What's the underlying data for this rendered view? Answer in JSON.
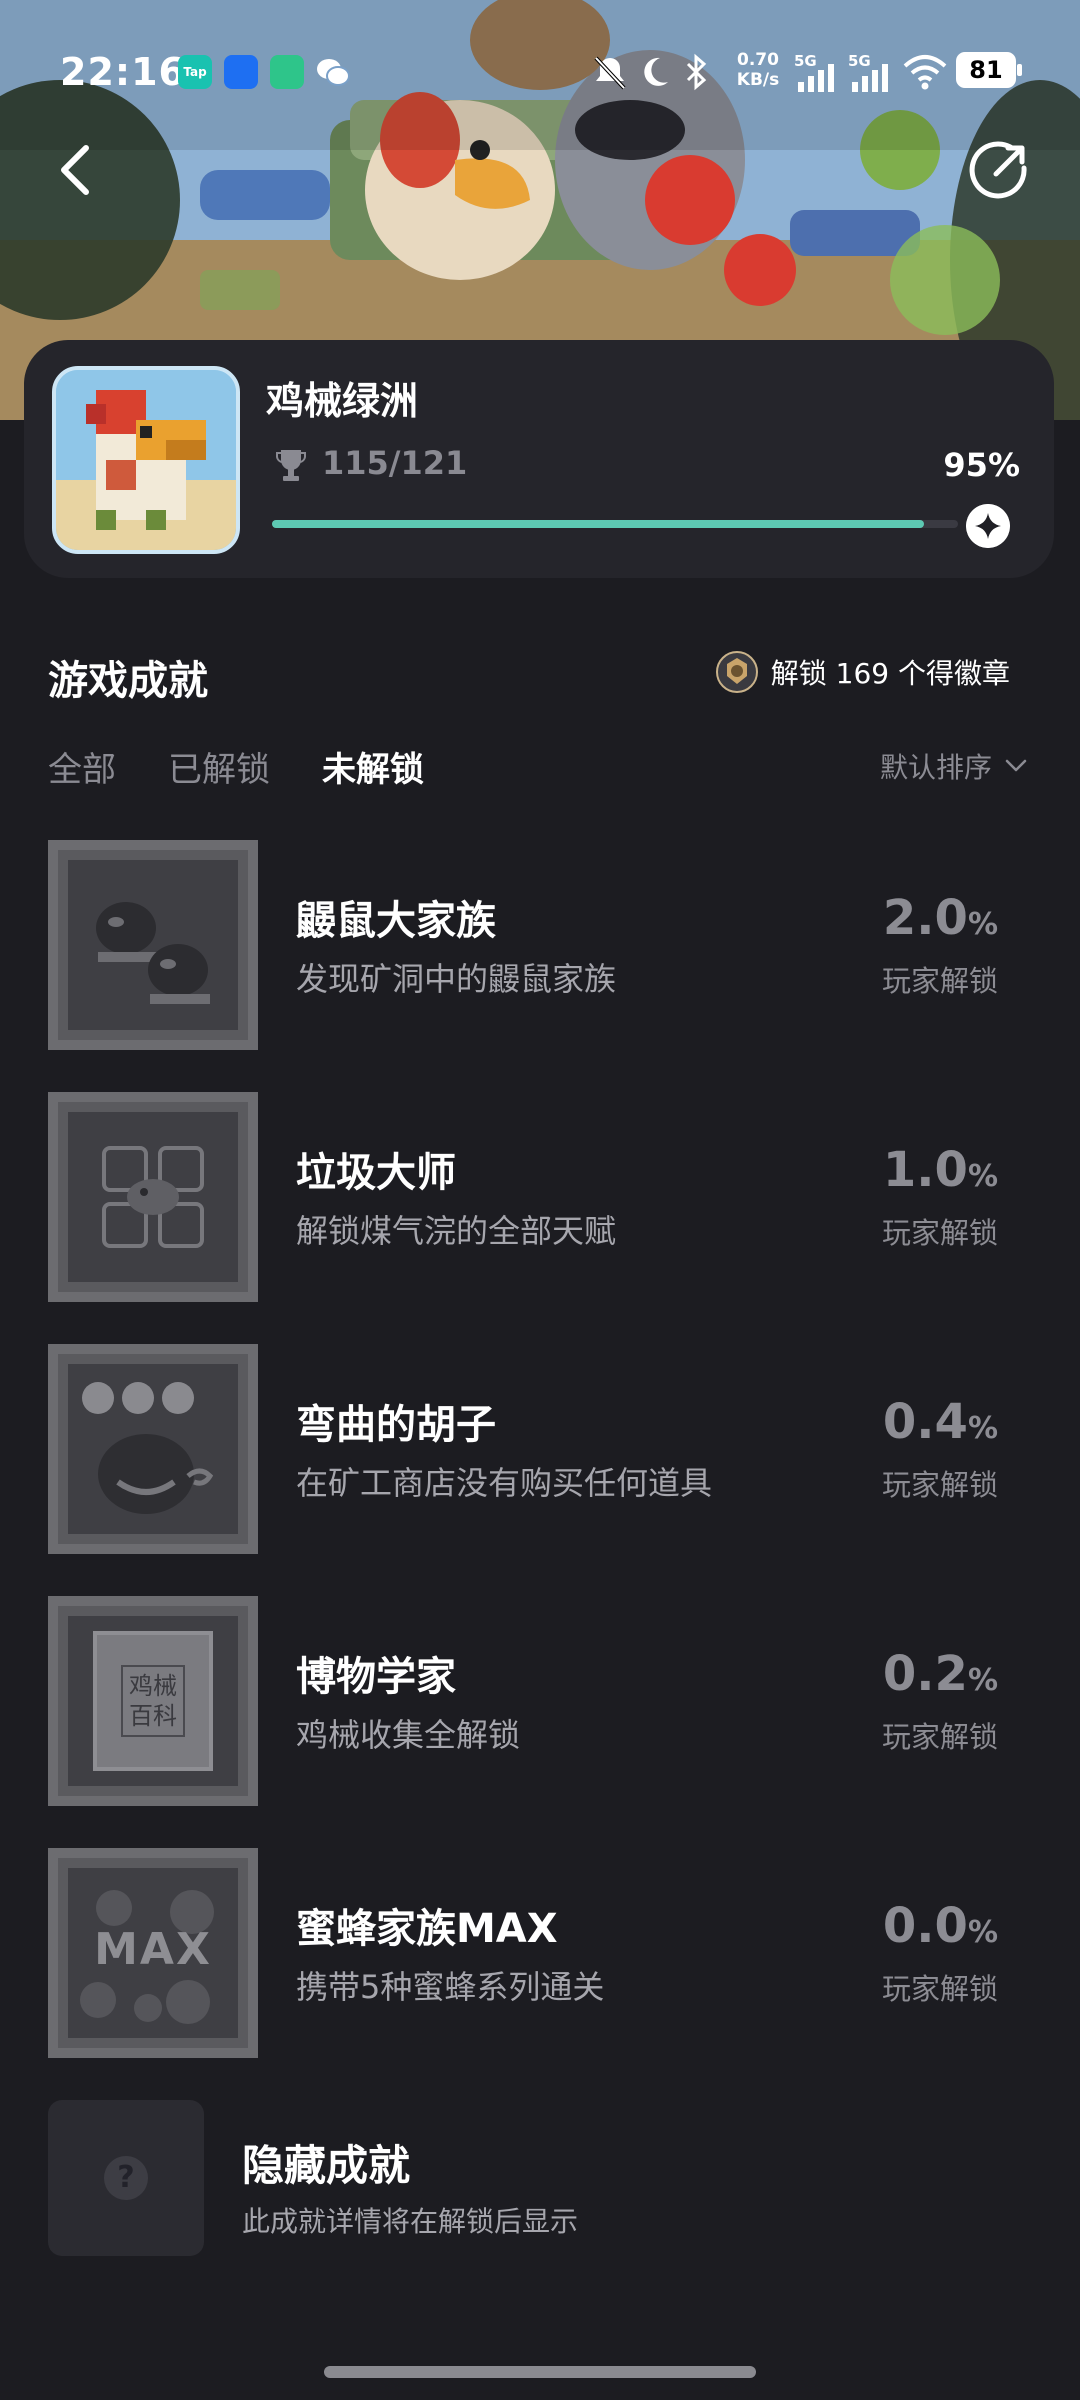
{
  "status_bar": {
    "time": "22:16",
    "apps": [
      "Tap",
      "transfer-app-icon",
      "box-app-icon",
      "wechat-icon"
    ],
    "net_speed_value": "0.70",
    "net_speed_unit": "KB/s",
    "sim1": "5G",
    "sim2": "5G",
    "battery": "81"
  },
  "nav": {
    "back_icon": "chevron-left-icon",
    "share_icon": "share-icon"
  },
  "game": {
    "title": "鸡械绿洲",
    "trophies": "115/121",
    "percent_text": "95%",
    "progress": 0.95
  },
  "achievements_section": {
    "title": "游戏成就",
    "badge_text": "解锁 169 个得徽章"
  },
  "tabs": [
    {
      "label": "全部",
      "active": false
    },
    {
      "label": "已解锁",
      "active": false
    },
    {
      "label": "未解锁",
      "active": true
    }
  ],
  "sort_label": "默认排序",
  "achievements": [
    {
      "name": "鼹鼠大家族",
      "desc": "发现矿洞中的鼹鼠家族",
      "rate": "2.0",
      "unit": "%",
      "rate_label": "玩家解锁"
    },
    {
      "name": "垃圾大师",
      "desc": "解锁煤气浣的全部天赋",
      "rate": "1.0",
      "unit": "%",
      "rate_label": "玩家解锁"
    },
    {
      "name": "弯曲的胡子",
      "desc": "在矿工商店没有购买任何道具",
      "rate": "0.4",
      "unit": "%",
      "rate_label": "玩家解锁"
    },
    {
      "name": "博物学家",
      "desc": "鸡械收集全解锁",
      "rate": "0.2",
      "unit": "%",
      "rate_label": "玩家解锁",
      "thumb_text_1": "鸡械",
      "thumb_text_2": "百科"
    },
    {
      "name": "蜜蜂家族MAX",
      "desc": "携带5种蜜蜂系列通关",
      "rate": "0.0",
      "unit": "%",
      "rate_label": "玩家解锁",
      "thumb_text_1": "MAX"
    }
  ],
  "hidden": {
    "title": "隐藏成就",
    "desc": "此成就详情将在解锁后显示",
    "icon_text": "?"
  }
}
